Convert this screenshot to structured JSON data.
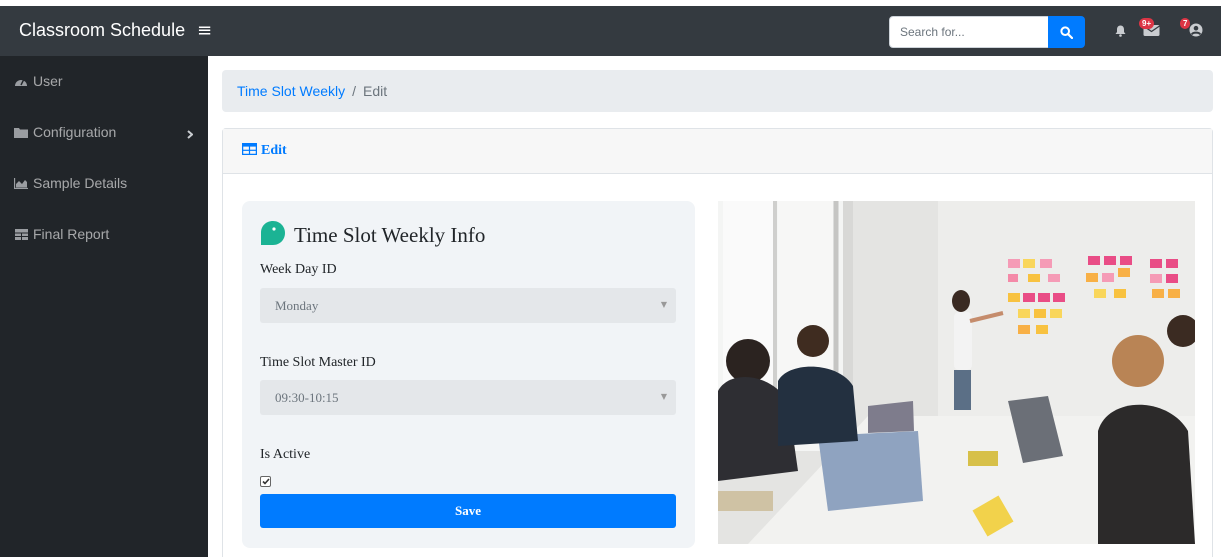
{
  "navbar": {
    "brand": "Classroom Schedule",
    "search_placeholder": "Search for...",
    "messages_badge": "9+",
    "alerts_badge": "7"
  },
  "sidebar": {
    "items": [
      {
        "label": "User",
        "icon": "tachometer-icon"
      },
      {
        "label": "Configuration",
        "icon": "folder-icon"
      },
      {
        "label": "Sample Details",
        "icon": "area-chart-icon"
      },
      {
        "label": "Final Report",
        "icon": "table-icon"
      }
    ]
  },
  "breadcrumb": {
    "parent": "Time Slot Weekly",
    "separator": "/",
    "current": "Edit"
  },
  "card": {
    "header_title": "Edit"
  },
  "form": {
    "title": "Time Slot Weekly Info",
    "week_day_label": "Week Day ID",
    "week_day_value": "Monday",
    "time_slot_label": "Time Slot Master ID",
    "time_slot_value": "09:30-10:15",
    "is_active_label": "Is Active",
    "is_active_checked": true,
    "save_label": "Save"
  },
  "colors": {
    "navbar": "#343a40",
    "sidebar": "#212529",
    "primary": "#007bff",
    "accent_teal": "#1bb394"
  }
}
